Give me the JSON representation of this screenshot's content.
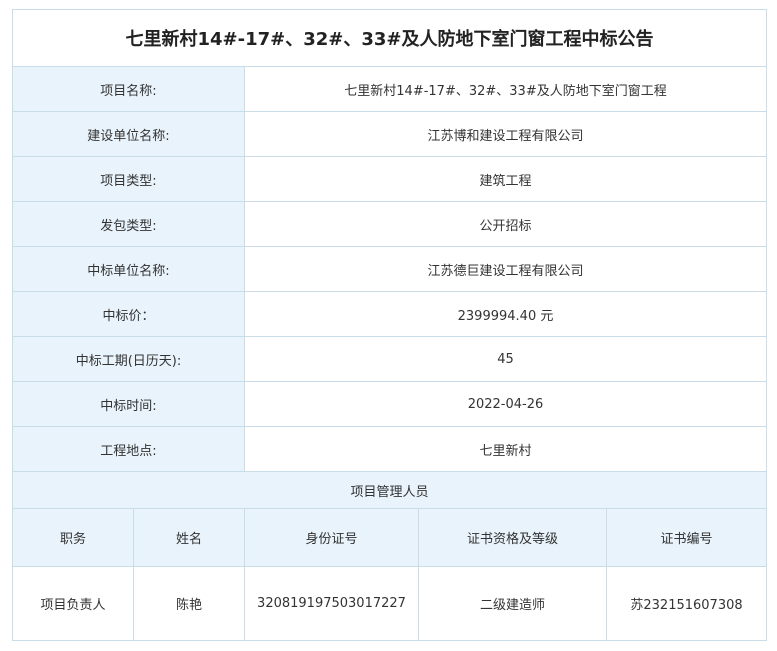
{
  "title": "七里新村14#-17#、32#、33#及人防地下室门窗工程中标公告",
  "rows": [
    {
      "label": "项目名称:",
      "value": "七里新村14#-17#、32#、33#及人防地下室门窗工程"
    },
    {
      "label": "建设单位名称:",
      "value": "江苏博和建设工程有限公司"
    },
    {
      "label": "项目类型:",
      "value": "建筑工程"
    },
    {
      "label": "发包类型:",
      "value": "公开招标"
    },
    {
      "label": "中标单位名称:",
      "value": "江苏德巨建设工程有限公司"
    },
    {
      "label": "中标价：",
      "value": "2399994.40 元"
    },
    {
      "label": "中标工期(日历天):",
      "value": "45"
    },
    {
      "label": "中标时间:",
      "value": "2022-04-26"
    },
    {
      "label": "工程地点:",
      "value": "七里新村"
    }
  ],
  "personnel": {
    "section_title": "项目管理人员",
    "headers": [
      "职务",
      "姓名",
      "身份证号",
      "证书资格及等级",
      "证书编号"
    ],
    "rows": [
      [
        "项目负责人",
        "陈艳",
        "320819197503017227",
        "二级建造师",
        "苏232151607308"
      ]
    ]
  },
  "colors": {
    "label_bg": "#e8f3fb",
    "border": "#c9dde8",
    "text": "#333333"
  }
}
